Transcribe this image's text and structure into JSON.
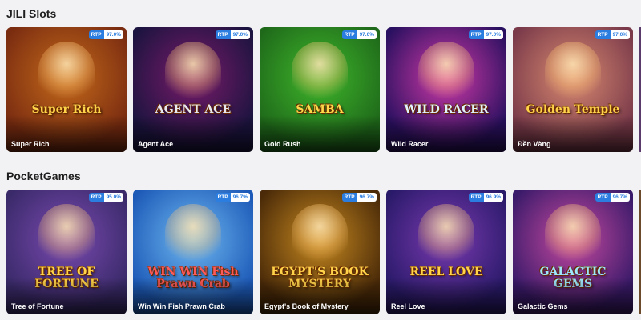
{
  "sections": [
    {
      "title": "JILI Slots",
      "games": [
        {
          "name": "Super Rich",
          "rtp_label": "RTP",
          "rtp": "97.0%",
          "logo": "Super Rich",
          "bg": "#7a2c10",
          "bg2": "#c56a1b",
          "logo_color": "#ffd34a"
        },
        {
          "name": "Agent Ace",
          "rtp_label": "RTP",
          "rtp": "97.0%",
          "logo": "AGENT ACE",
          "bg": "#1c1440",
          "bg2": "#7a1a6a",
          "logo_color": "#e8e8f0"
        },
        {
          "name": "Gold Rush",
          "rtp_label": "RTP",
          "rtp": "97.0%",
          "logo": "SAMBA",
          "bg": "#1f6a1a",
          "bg2": "#3fb62b",
          "logo_color": "#ffd94a"
        },
        {
          "name": "Wild Racer",
          "rtp_label": "RTP",
          "rtp": "97.0%",
          "logo": "WILD RACER",
          "bg": "#2a1060",
          "bg2": "#d23aa8",
          "logo_color": "#dff3ff"
        },
        {
          "name": "Đền Vàng",
          "rtp_label": "RTP",
          "rtp": "97.0%",
          "logo": "Golden Temple",
          "bg": "#7a3a4a",
          "bg2": "#d98a70",
          "logo_color": "#ffd24a"
        }
      ]
    },
    {
      "title": "PocketGames",
      "games": [
        {
          "name": "Tree of Fortune",
          "rtp_label": "RTP",
          "rtp": "95.0%",
          "logo": "TREE OF FORTUNE",
          "bg": "#3a2a6a",
          "bg2": "#7a4ab0",
          "logo_color": "#ffd34a"
        },
        {
          "name": "Win Win Fish Prawn Crab",
          "rtp_label": "RTP",
          "rtp": "96.7%",
          "logo": "WIN WIN Fish Prawn Crab",
          "bg": "#1d5ab8",
          "bg2": "#6fb8f0",
          "logo_color": "#ff5a5a"
        },
        {
          "name": "Egypt's Book of Mystery",
          "rtp_label": "RTP",
          "rtp": "96.7%",
          "logo": "EGYPT'S BOOK MYSTERY",
          "bg": "#4a2a08",
          "bg2": "#c88a20",
          "logo_color": "#ffd34a"
        },
        {
          "name": "Reel Love",
          "rtp_label": "RTP",
          "rtp": "96.9%",
          "logo": "REEL LOVE",
          "bg": "#2a1a6a",
          "bg2": "#7a3ab0",
          "logo_color": "#ffd34a"
        },
        {
          "name": "Galactic Gems",
          "rtp_label": "RTP",
          "rtp": "96.7%",
          "logo": "GALACTIC GEMS",
          "bg": "#3a1a6a",
          "bg2": "#c84aa0",
          "logo_color": "#9ee8ff"
        }
      ]
    }
  ]
}
